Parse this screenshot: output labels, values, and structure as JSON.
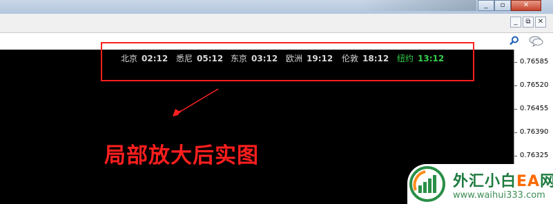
{
  "window": {
    "controls": {
      "minimize": "_",
      "restore": "▫",
      "close": "✕"
    },
    "mdi_controls": {
      "minimize": "_",
      "restore": "⧉",
      "close": "✕"
    }
  },
  "chart": {
    "background": "#000000",
    "price_axis": [
      "0.76585",
      "0.76520",
      "0.76455",
      "0.76390",
      "0.76325"
    ]
  },
  "clocks": [
    {
      "city": "北京",
      "time": "02:12",
      "active": false
    },
    {
      "city": "悉尼",
      "time": "05:12",
      "active": false
    },
    {
      "city": "东京",
      "time": "03:12",
      "active": false
    },
    {
      "city": "欧洲",
      "time": "19:12",
      "active": false
    },
    {
      "city": "伦敦",
      "time": "18:12",
      "active": false
    },
    {
      "city": "纽约",
      "time": "13:12",
      "active": true
    }
  ],
  "annotation": {
    "text": "局部放大后实图",
    "color": "#ff1e1e"
  },
  "watermark": {
    "title_cn": "外汇小白",
    "title_ea": "EA",
    "title_tail": "网",
    "url": "www.waihui333.com"
  },
  "icons": [
    "search-icon",
    "chat-icon",
    "window-minimize-icon",
    "window-restore-icon",
    "window-close-icon"
  ]
}
